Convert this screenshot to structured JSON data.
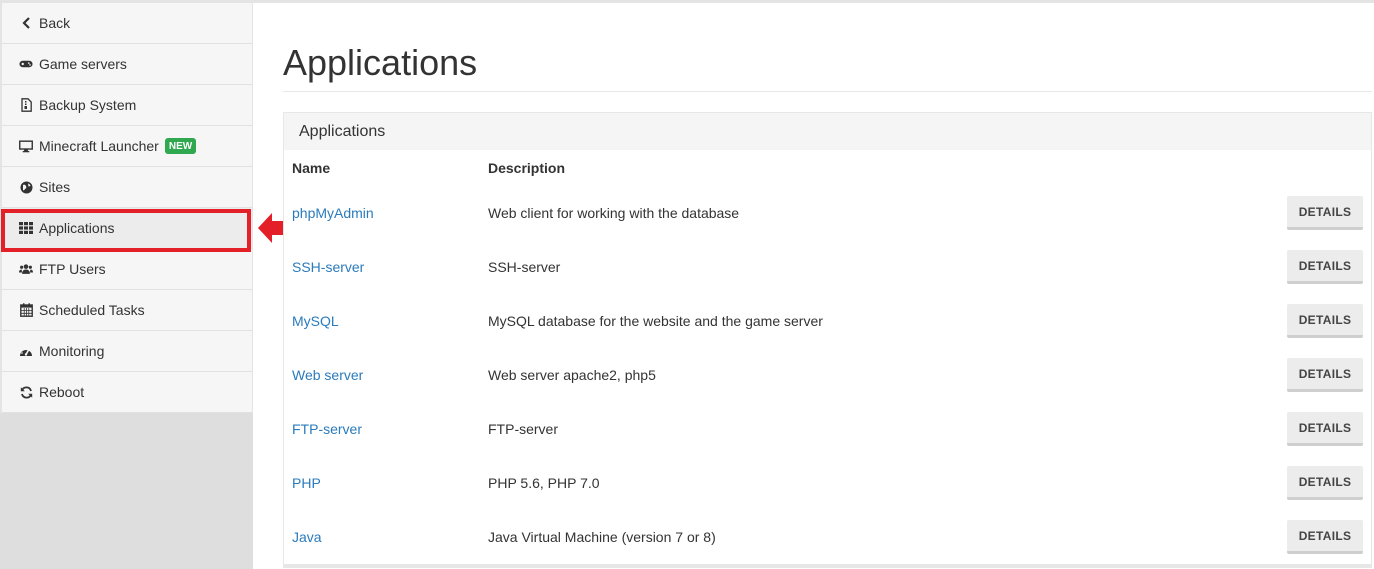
{
  "sidebar": {
    "items": [
      {
        "label": "Back",
        "icon": "chevron-left-icon"
      },
      {
        "label": "Game servers",
        "icon": "gamepad-icon"
      },
      {
        "label": "Backup System",
        "icon": "file-archive-icon"
      },
      {
        "label": "Minecraft Launcher",
        "icon": "desktop-icon",
        "badge": "NEW"
      },
      {
        "label": "Sites",
        "icon": "globe-icon"
      },
      {
        "label": "Applications",
        "icon": "th-grid-icon",
        "active": true
      },
      {
        "label": "FTP Users",
        "icon": "users-icon"
      },
      {
        "label": "Scheduled Tasks",
        "icon": "calendar-icon"
      },
      {
        "label": "Monitoring",
        "icon": "dashboard-icon"
      },
      {
        "label": "Reboot",
        "icon": "refresh-icon"
      }
    ],
    "highlight_color": "#e32027",
    "badge_color": "#2fa84f"
  },
  "main": {
    "title": "Applications",
    "panel": {
      "heading": "Applications",
      "columns": {
        "name": "Name",
        "description": "Description"
      },
      "rows": [
        {
          "name": "phpMyAdmin",
          "description": "Web client for working with the database",
          "action": "DETAILS"
        },
        {
          "name": "SSH-server",
          "description": "SSH-server",
          "action": "DETAILS"
        },
        {
          "name": "MySQL",
          "description": "MySQL database for the website and the game server",
          "action": "DETAILS"
        },
        {
          "name": "Web server",
          "description": "Web server apache2, php5",
          "action": "DETAILS"
        },
        {
          "name": "FTP-server",
          "description": "FTP-server",
          "action": "DETAILS"
        },
        {
          "name": "PHP",
          "description": "PHP 5.6, PHP 7.0",
          "action": "DETAILS"
        },
        {
          "name": "Java",
          "description": "Java Virtual Machine (version 7 or 8)",
          "action": "DETAILS"
        }
      ]
    },
    "link_color": "#2a7bbd"
  }
}
